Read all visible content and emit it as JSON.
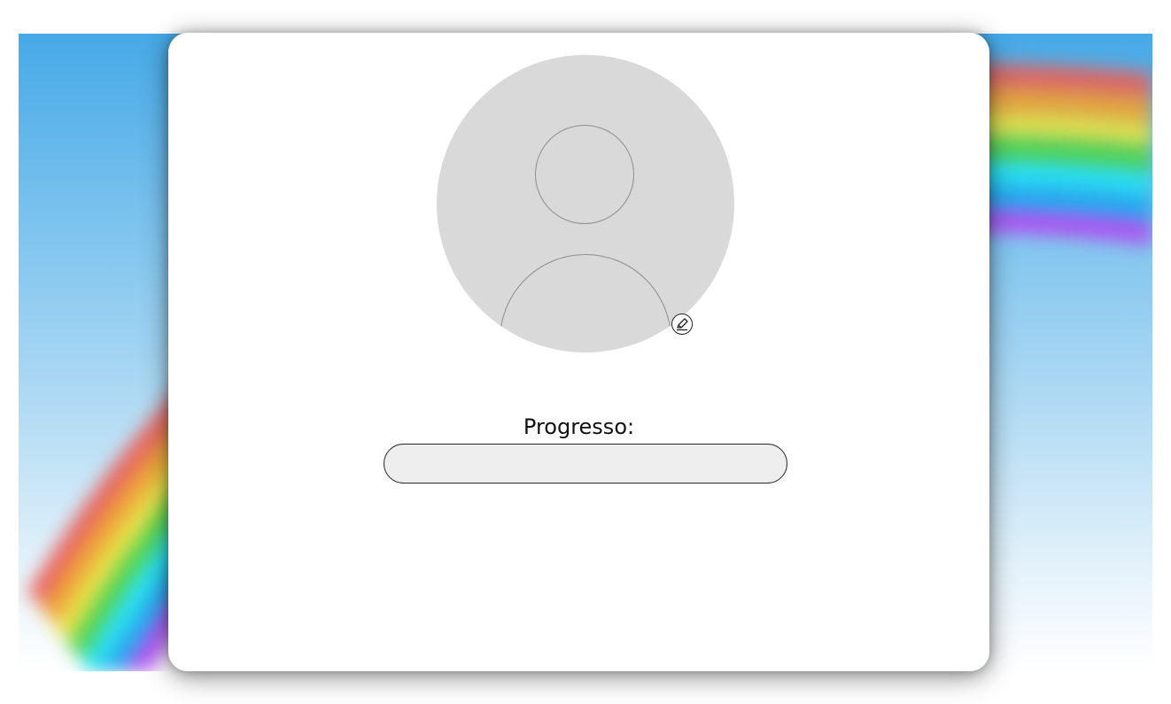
{
  "profile": {
    "avatar_icon": "user-silhouette-icon",
    "edit_icon": "pencil-edit-icon"
  },
  "progress": {
    "label": "Progresso:",
    "value": 0
  },
  "background": {
    "sky_color": "#46a9e6",
    "card_color": "#ffffff",
    "avatar_color": "#d9d9d9"
  }
}
